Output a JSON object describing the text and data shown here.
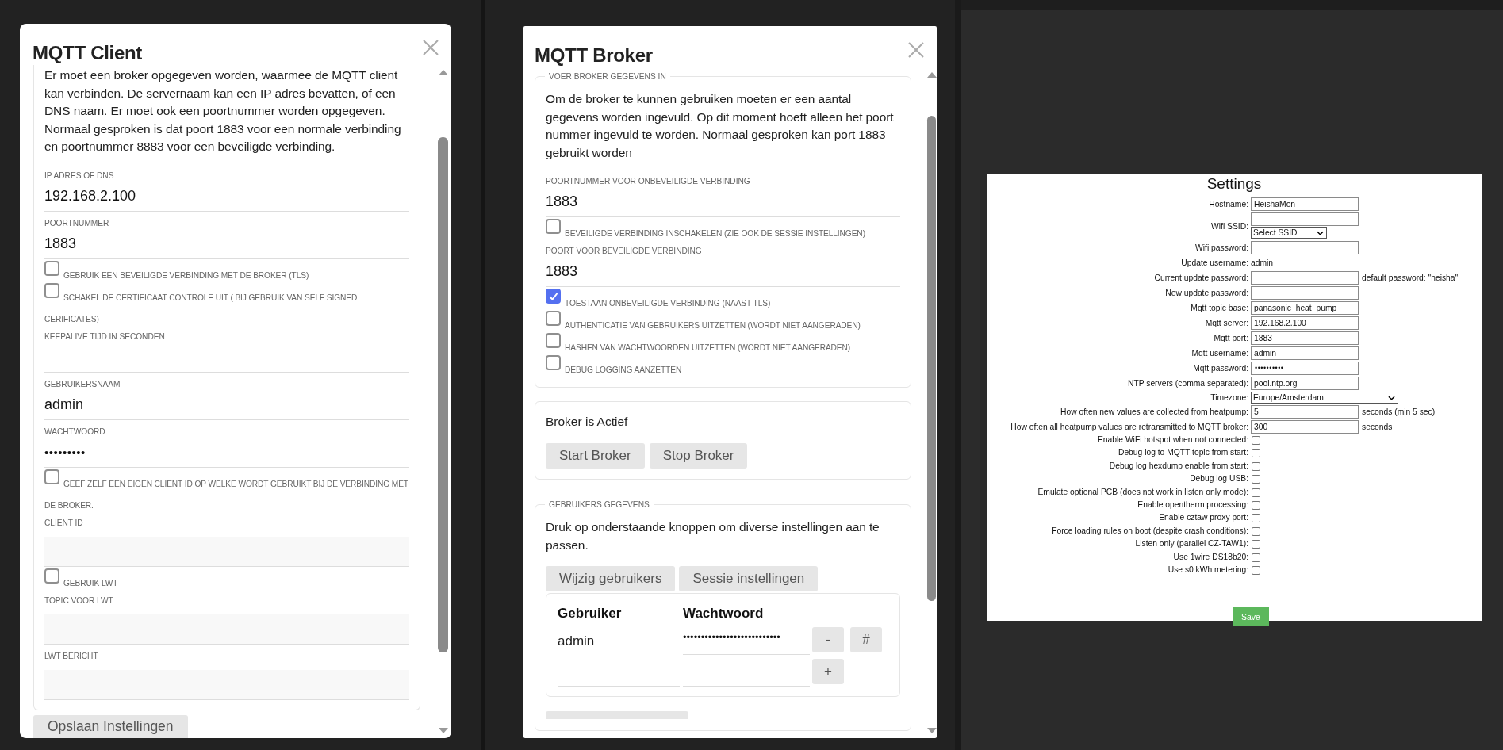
{
  "client": {
    "title": "MQTT Client",
    "intro": "Er moet een broker opgegeven worden, waarmee de MQTT client kan verbinden. De servernaam kan een IP adres bevatten, of een DNS naam. Er moet ook een poortnummer worden opgegeven. Normaal gesproken is dat poort 1883 voor een normale verbinding en poortnummer 8883 voor een beveiligde verbinding.",
    "fields": [
      {
        "kind": "text",
        "label": "IP ADRES OF DNS",
        "value": "192.168.2.100"
      },
      {
        "kind": "text",
        "label": "POORTNUMMER",
        "value": "1883"
      },
      {
        "kind": "checkbox",
        "label": "GEBRUIK EEN BEVEILIGDE VERBINDING MET DE BROKER (TLS)",
        "checked": false
      },
      {
        "kind": "checkbox",
        "label": "SCHAKEL DE CERTIFICAAT CONTROLE UIT ( BIJ GEBRUIK VAN SELF SIGNED CERIFICATES)",
        "checked": false
      },
      {
        "kind": "text",
        "label": "KEEPALIVE TIJD IN SECONDEN"
      },
      {
        "kind": "text",
        "label": "GEBRUIKERSNAAM",
        "value": "admin"
      },
      {
        "kind": "password",
        "label": "WACHTWOORD",
        "value": "•••••••••"
      },
      {
        "kind": "checkbox",
        "label": "GEEF ZELF EEN EIGEN CLIENT ID OP WELKE WORDT GEBRUIKT BIJ DE VERBINDING MET DE BROKER.",
        "checked": false
      },
      {
        "kind": "filled",
        "label": "CLIENT ID"
      },
      {
        "kind": "checkbox",
        "label": "GEBRUIK LWT",
        "checked": false
      },
      {
        "kind": "filled",
        "label": "TOPIC VOOR LWT"
      },
      {
        "kind": "filled",
        "label": "LWT BERICHT"
      }
    ],
    "save": "Opslaan Instellingen"
  },
  "broker": {
    "title": "MQTT Broker",
    "settings": {
      "legend": "VOER BROKER GEGEVENS IN",
      "intro": "Om de broker te kunnen gebruiken moeten er een aantal gegevens worden ingevuld. Op dit moment hoeft alleen het poort nummer ingevuld te worden. Normaal gesproken kan port 1883 gebruikt worden",
      "fields": [
        {
          "kind": "text",
          "label": "POORTNUMMER VOOR ONBEVEILIGDE VERBINDING",
          "value": "1883"
        },
        {
          "kind": "checkbox",
          "label": "BEVEILIGDE VERBINDING INSCHAKELEN (ZIE OOK DE SESSIE INSTELLINGEN)",
          "checked": false
        },
        {
          "kind": "text",
          "label": "POORT VOOR BEVEILIGDE VERBINDING",
          "value": "1883"
        },
        {
          "kind": "checkbox",
          "label": "TOESTAAN ONBEVEILIGDE VERBINDING (NAAST TLS)",
          "checked": true
        },
        {
          "kind": "checkbox",
          "label": "AUTHENTICATIE VAN GEBRUIKERS UITZETTEN (WORDT NIET AANGERADEN)",
          "checked": false
        },
        {
          "kind": "checkbox",
          "label": "HASHEN VAN WACHTWOORDEN UITZETTEN (WORDT NIET AANGERADEN)",
          "checked": false
        },
        {
          "kind": "checkbox",
          "label": "DEBUG LOGGING AANZETTEN",
          "checked": false
        }
      ]
    },
    "status": {
      "text": "Broker is Actief",
      "buttons": [
        "Start Broker",
        "Stop Broker"
      ]
    },
    "users": {
      "legend": "GEBRUIKERS GEGEVENS",
      "intro": "Druk op onderstaande knoppen om diverse instellingen aan te passen.",
      "buttons": [
        "Wijzig gebruikers",
        "Sessie instellingen"
      ],
      "columns": [
        "Gebruiker",
        "Wachtwoord"
      ],
      "rows": [
        {
          "user": "admin",
          "password": "•••••••••••••••••••••••••••",
          "actions": [
            "-",
            "#"
          ]
        },
        {
          "actions": [
            "+"
          ]
        }
      ]
    }
  },
  "settings": {
    "title": "Settings",
    "rows": [
      {
        "kind": "input",
        "label": "Hostname:",
        "value": "HeishaMon"
      },
      {
        "kind": "ssid",
        "label": "Wifi SSID:",
        "select": "Select SSID"
      },
      {
        "kind": "input",
        "label": "Wifi password:"
      },
      {
        "kind": "text",
        "label": "Update username:",
        "value": "admin"
      },
      {
        "kind": "input",
        "label": "Current update password:",
        "note": "default password: \"heisha\""
      },
      {
        "kind": "input",
        "label": "New update password:"
      },
      {
        "kind": "input",
        "label": "Mqtt topic base:",
        "value": "panasonic_heat_pump"
      },
      {
        "kind": "input",
        "label": "Mqtt server:",
        "value": "192.168.2.100"
      },
      {
        "kind": "input",
        "label": "Mqtt port:",
        "value": "1883"
      },
      {
        "kind": "input",
        "label": "Mqtt username:",
        "value": "admin"
      },
      {
        "kind": "password",
        "label": "Mqtt password:",
        "value": "••••••••••"
      },
      {
        "kind": "input",
        "label": "NTP servers (comma separated):",
        "value": "pool.ntp.org"
      },
      {
        "kind": "select",
        "label": "Timezone:",
        "value": "Europe/Amsterdam"
      },
      {
        "kind": "input",
        "label": "How often new values are collected from heatpump:",
        "value": "5",
        "note": "seconds (min 5 sec)"
      },
      {
        "kind": "input",
        "label": "How often all heatpump values are retransmitted to MQTT broker:",
        "value": "300",
        "note": "seconds"
      },
      {
        "kind": "checkbox",
        "label": "Enable WiFi hotspot when not connected:",
        "checked": false
      },
      {
        "kind": "checkbox",
        "label": "Debug log to MQTT topic from start:",
        "checked": false
      },
      {
        "kind": "checkbox",
        "label": "Debug log hexdump enable from start:",
        "checked": false
      },
      {
        "kind": "checkbox",
        "label": "Debug log USB:",
        "checked": false
      },
      {
        "kind": "checkbox",
        "label": "Emulate optional PCB (does not work in listen only mode):",
        "checked": false
      },
      {
        "kind": "checkbox",
        "label": "Enable opentherm processing:",
        "checked": false
      },
      {
        "kind": "checkbox",
        "label": "Enable cztaw proxy port:",
        "checked": false
      },
      {
        "kind": "checkbox",
        "label": "Force loading rules on boot (despite crash conditions):",
        "checked": false
      },
      {
        "kind": "checkbox",
        "label": "Listen only (parallel CZ-TAW1):",
        "checked": false
      },
      {
        "kind": "checkbox",
        "label": "Use 1wire DS18b20:",
        "checked": false
      },
      {
        "kind": "checkbox",
        "label": "Use s0 kWh metering:",
        "checked": false
      }
    ],
    "save": "Save"
  }
}
